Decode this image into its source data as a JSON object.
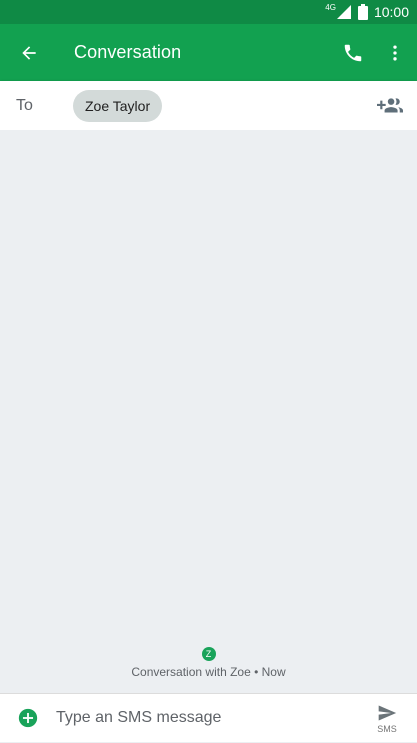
{
  "status_bar": {
    "network": "4G",
    "time": "10:00"
  },
  "app_bar": {
    "title": "Conversation",
    "icons": [
      "arrow-back-icon",
      "phone-icon",
      "more-vert-icon"
    ]
  },
  "recipients": {
    "to_label": "To",
    "chips": [
      "Zoe Taylor"
    ]
  },
  "conversation": {
    "avatar_letter": "Z",
    "info": "Conversation with Zoe • Now"
  },
  "compose": {
    "placeholder": "Type an SMS message",
    "send_label": "SMS"
  },
  "colors": {
    "status_bar": "#0f8a45",
    "app_bar": "#12a150",
    "accent": "#19a35a",
    "background": "#eceff2"
  }
}
